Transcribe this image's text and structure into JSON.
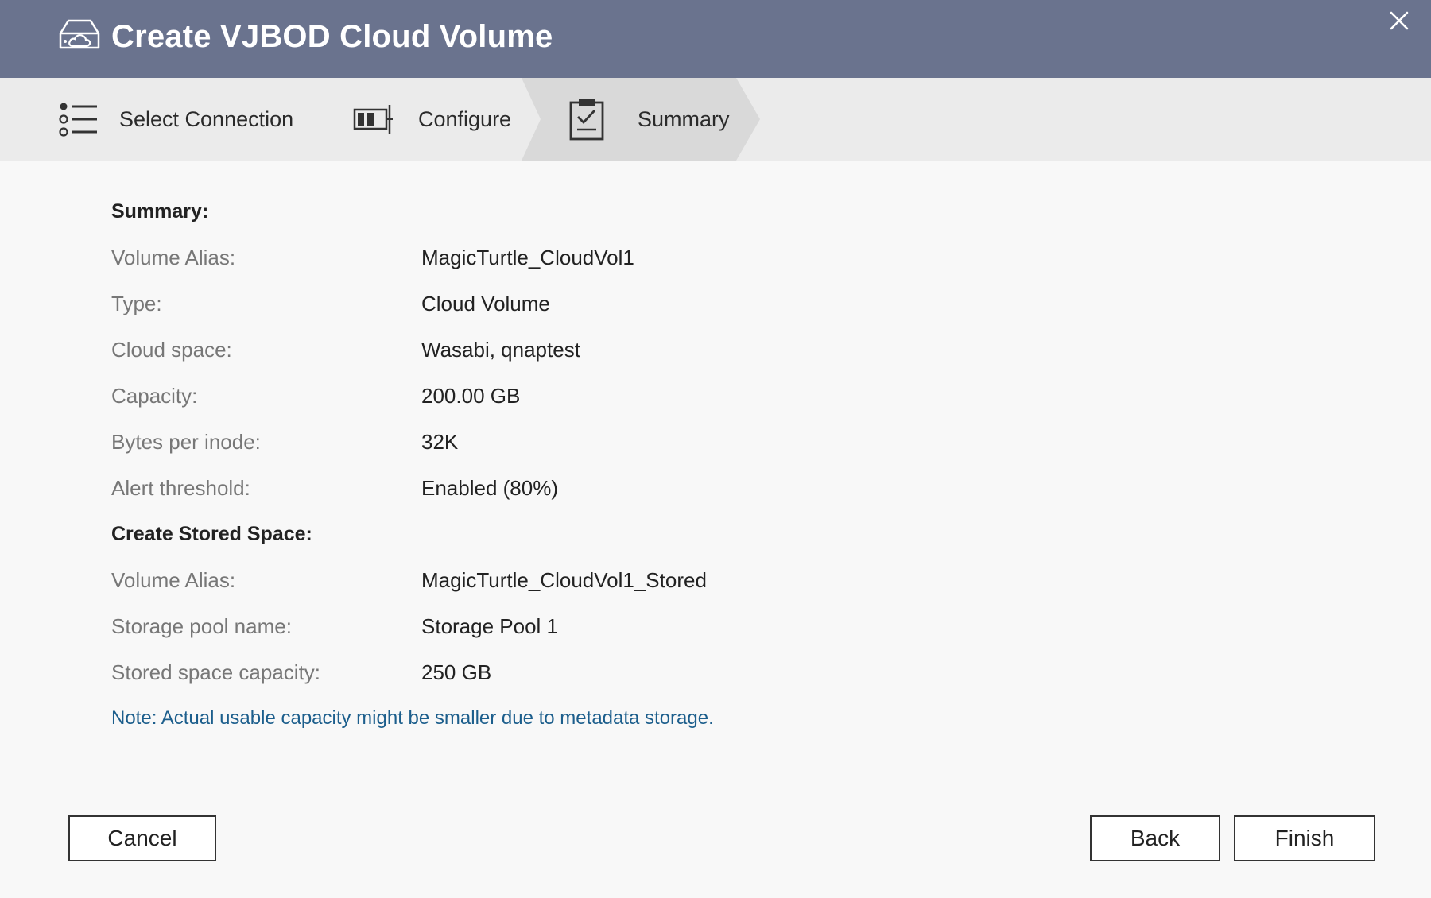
{
  "window": {
    "title": "Create VJBOD Cloud Volume",
    "icon": "cloud-drive-icon",
    "close_icon": "close-icon"
  },
  "steps": [
    {
      "label": "Select Connection",
      "icon": "list-icon",
      "active": false
    },
    {
      "label": "Configure",
      "icon": "configure-icon",
      "active": false
    },
    {
      "label": "Summary",
      "icon": "clipboard-check-icon",
      "active": true
    }
  ],
  "summary": {
    "title": "Summary:",
    "rows": [
      {
        "label": "Volume Alias:",
        "value": "MagicTurtle_CloudVol1"
      },
      {
        "label": "Type:",
        "value": "Cloud Volume"
      },
      {
        "label": "Cloud space:",
        "value": "Wasabi, qnaptest"
      },
      {
        "label": "Capacity:",
        "value": "200.00 GB"
      },
      {
        "label": "Bytes per inode:",
        "value": "32K"
      },
      {
        "label": "Alert threshold:",
        "value": "Enabled (80%)"
      }
    ]
  },
  "stored_space": {
    "title": "Create Stored Space:",
    "rows": [
      {
        "label": "Volume Alias:",
        "value": "MagicTurtle_CloudVol1_Stored"
      },
      {
        "label": "Storage pool name:",
        "value": "Storage Pool 1"
      },
      {
        "label": "Stored space capacity:",
        "value": "250 GB"
      }
    ]
  },
  "note": "Note: Actual usable capacity might be smaller due to metadata storage.",
  "buttons": {
    "cancel": "Cancel",
    "back": "Back",
    "finish": "Finish"
  },
  "colors": {
    "titlebar": "#6a738e",
    "stepsbar": "#ebebeb",
    "active_step": "#d9d9d9",
    "note": "#1c5e8c",
    "background": "#f8f8f8"
  }
}
